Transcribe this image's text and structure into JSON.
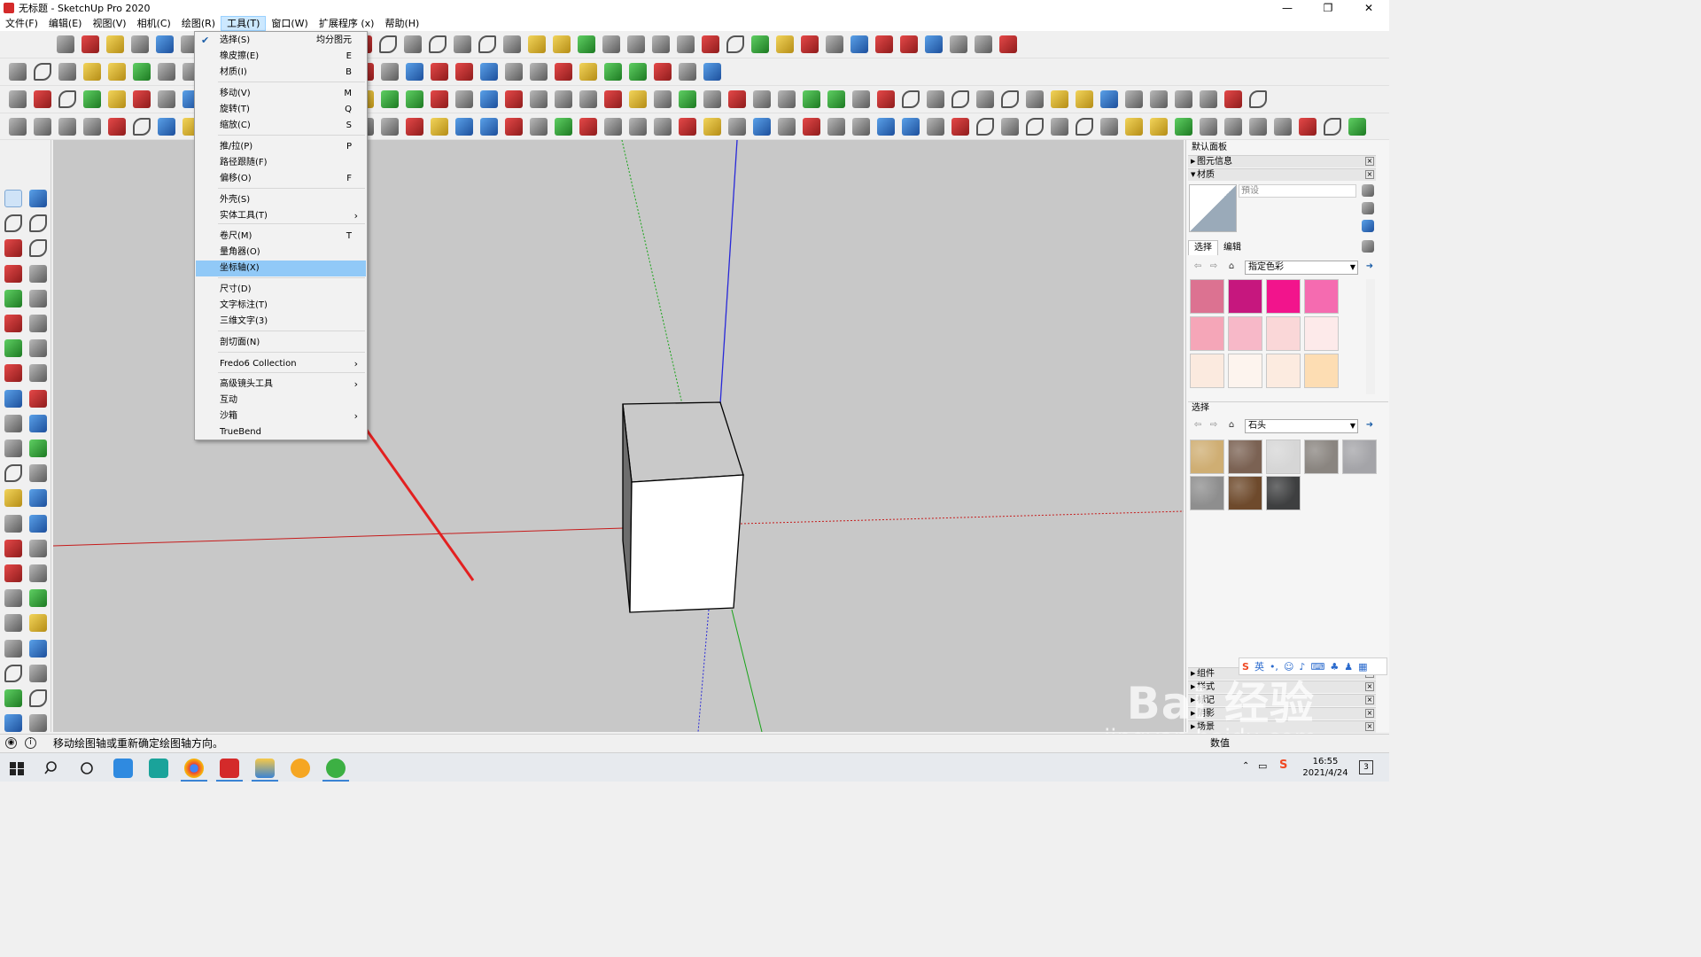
{
  "window": {
    "title": "无标题 - SketchUp Pro 2020",
    "controls": [
      "—",
      "❐",
      "✕"
    ]
  },
  "menubar": {
    "items": [
      "文件(F)",
      "编辑(E)",
      "视图(V)",
      "相机(C)",
      "绘图(R)",
      "工具(T)",
      "窗口(W)",
      "扩展程序 (x)",
      "帮助(H)"
    ],
    "active_index": 5
  },
  "tools_menu": {
    "items": [
      {
        "label": "选择(S)",
        "shortcut": "均分图元",
        "checked": true
      },
      {
        "label": "橡皮擦(E)",
        "shortcut": "E"
      },
      {
        "label": "材质(I)",
        "shortcut": "B"
      },
      {
        "label": "移动(V)",
        "shortcut": "M"
      },
      {
        "label": "旋转(T)",
        "shortcut": "Q"
      },
      {
        "label": "缩放(C)",
        "shortcut": "S"
      },
      {
        "label": "推/拉(P)",
        "shortcut": "P"
      },
      {
        "label": "路径跟随(F)",
        "shortcut": ""
      },
      {
        "label": "偏移(O)",
        "shortcut": "F"
      },
      {
        "label": "外壳(S)",
        "shortcut": ""
      },
      {
        "label": "实体工具(T)",
        "shortcut": "",
        "submenu": true
      },
      {
        "label": "卷尺(M)",
        "shortcut": "T"
      },
      {
        "label": "量角器(O)",
        "shortcut": ""
      },
      {
        "label": "坐标轴(X)",
        "shortcut": "",
        "highlighted": true
      },
      {
        "label": "尺寸(D)",
        "shortcut": ""
      },
      {
        "label": "文字标注(T)",
        "shortcut": ""
      },
      {
        "label": "三维文字(3)",
        "shortcut": ""
      },
      {
        "label": "剖切面(N)",
        "shortcut": ""
      },
      {
        "label": "Fredo6 Collection",
        "shortcut": "",
        "submenu": true
      },
      {
        "label": "高级镜头工具",
        "shortcut": "",
        "submenu": true
      },
      {
        "label": "互动",
        "shortcut": ""
      },
      {
        "label": "沙箱",
        "shortcut": "",
        "submenu": true
      },
      {
        "label": "TrueBend",
        "shortcut": ""
      }
    ],
    "submenu_glyph": "›",
    "check_glyph": "✔"
  },
  "right_panel": {
    "title": "默认面板",
    "entity_info": "图元信息",
    "materials": "材质",
    "name_placeholder": "預设",
    "tabs": [
      "选择",
      "编辑"
    ],
    "colors_library": "指定色彩",
    "stone_section": "选择",
    "stone_library": "石头",
    "bottom_sections": [
      "组件",
      "样式",
      "标记",
      "阴影",
      "场景"
    ],
    "color_swatches": [
      "#dc7291",
      "#c6177e",
      "#f2148c",
      "#f56bb0",
      "#f5a6b8",
      "#f7b8c8",
      "#fad7d8",
      "#fdeaea",
      "#fbeadf",
      "#fdf4ee",
      "#fcebe0",
      "#fdddb3"
    ],
    "stone_swatches": [
      "#cfae73",
      "#7b6253",
      "#d6d6d6",
      "#8a8580",
      "#a4a4a8",
      "#8e8e8e",
      "#6e4a2c",
      "#3e3f40"
    ]
  },
  "status": {
    "message": "移动绘图轴或重新确定绘图轴方向。",
    "value_label": "数值"
  },
  "ime": {
    "brand": "S",
    "lang": "英"
  },
  "watermark": {
    "main": "Bai 经验",
    "sub": "jingyan.baidu.com"
  },
  "taskbar": {
    "time": "16:55",
    "date": "2021/4/24",
    "notifications": "3"
  },
  "colors": {
    "axis_red": "#c61b1b",
    "axis_green": "#17a317",
    "axis_blue": "#2828d8",
    "arrow": "#e32020",
    "menu_highlight": "#91c9f7"
  }
}
